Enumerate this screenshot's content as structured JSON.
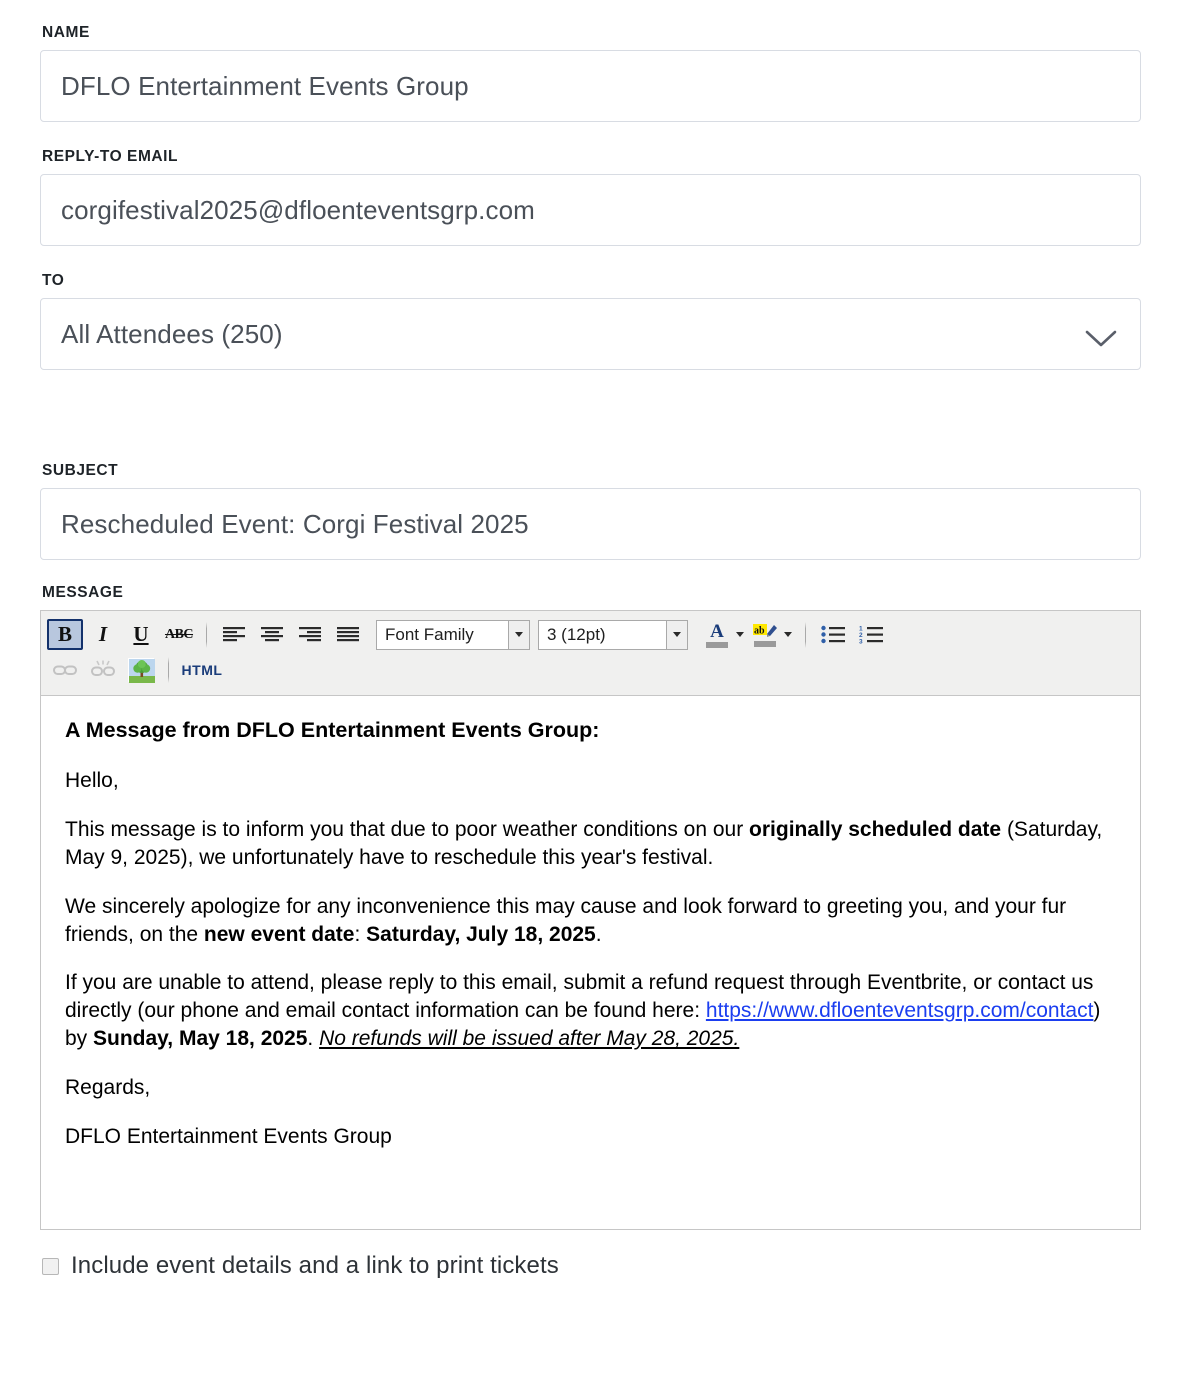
{
  "form": {
    "name": {
      "label": "NAME",
      "value": "DFLO Entertainment Events Group"
    },
    "reply_to_email": {
      "label": "REPLY-TO EMAIL",
      "value": "corgifestival2025@dfloenteventsgrp.com"
    },
    "to": {
      "label": "TO",
      "value": "All Attendees (250)",
      "icon": "chevron-down-icon"
    },
    "subject": {
      "label": "SUBJECT",
      "value": "Rescheduled Event: Corgi Festival 2025"
    },
    "message": {
      "label": "MESSAGE"
    }
  },
  "toolbar": {
    "bold": {
      "label": "B",
      "name": "bold-button",
      "active": true
    },
    "italic": {
      "label": "I",
      "name": "italic-button"
    },
    "underline": {
      "label": "U",
      "name": "underline-button"
    },
    "strikethrough": {
      "label": "ABC",
      "name": "strikethrough-button"
    },
    "align_left": {
      "name": "align-left-icon"
    },
    "align_center": {
      "name": "align-center-icon"
    },
    "align_right": {
      "name": "align-right-icon"
    },
    "align_justify": {
      "name": "align-justify-icon"
    },
    "font_family": {
      "value": "Font Family"
    },
    "font_size": {
      "value": "3 (12pt)"
    },
    "text_color": {
      "name": "text-color-icon",
      "letter": "A",
      "swatch": "#9a9a9a"
    },
    "highlight_color": {
      "name": "highlight-color-icon",
      "letter": "ab",
      "swatch": "#9a9a9a",
      "highlight": "#ffe800"
    },
    "bullet_list": {
      "name": "bullet-list-icon"
    },
    "numbered_list": {
      "name": "numbered-list-icon"
    },
    "insert_link": {
      "name": "link-icon",
      "disabled": true
    },
    "unlink": {
      "name": "unlink-icon",
      "disabled": true
    },
    "insert_image": {
      "name": "image-icon"
    },
    "html_source": {
      "label": "HTML",
      "name": "html-source-button"
    }
  },
  "message_body": {
    "heading": "A Message from DFLO Entertainment Events Group:",
    "greeting": "Hello,",
    "para2": {
      "part1": "This message is to inform you that due to poor weather conditions on our ",
      "bold1": "originally scheduled date",
      "part2": " (Saturday, May 9, 2025), we unfortunately have to reschedule this year's festival."
    },
    "para3": {
      "part1": "We sincerely apologize for any inconvenience this may cause and look forward to greeting you, and your fur friends, on the ",
      "bold1": "new event date",
      "part2": ": ",
      "bold2": "Saturday, July 18, 2025",
      "part3": "."
    },
    "para4": {
      "part1": "If you are unable to attend, please reply to this email, submit a refund request through Eventbrite, or contact us directly (our phone and email contact information can be found here: ",
      "link": "https://www.dfloenteventsgrp.com/contact",
      "part2": ") by ",
      "bold1": "Sunday, May 18, 2025",
      "part3": ". ",
      "italic_underline": "No refunds will be issued after May 28, 2025."
    },
    "signoff": "Regards,",
    "signature": "DFLO Entertainment Events Group"
  },
  "footer": {
    "include_details_checkbox": {
      "label": "Include event details and a link to print tickets",
      "checked": false
    }
  }
}
